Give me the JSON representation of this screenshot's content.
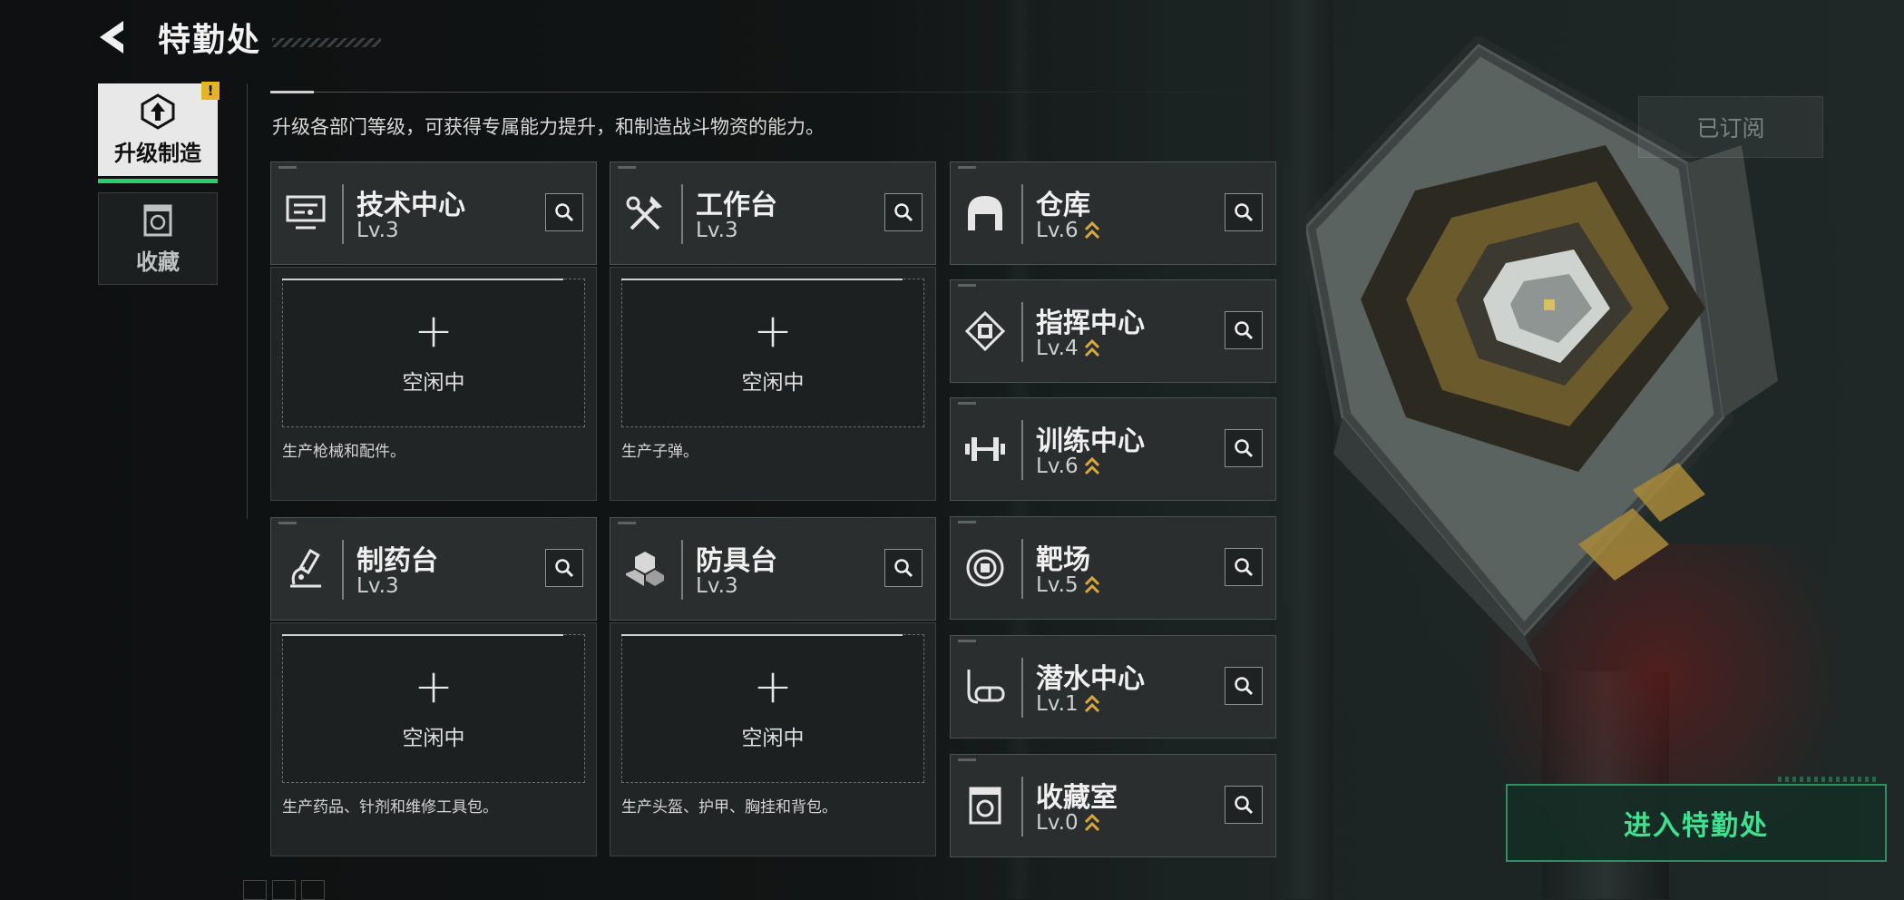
{
  "header": {
    "title": "特勤处"
  },
  "sidebar": {
    "items": [
      {
        "label": "升级制造",
        "active": true,
        "badge": "!"
      },
      {
        "label": "收藏",
        "active": false
      }
    ]
  },
  "description": "升级各部门等级，可获得专属能力提升，和制造战斗物资的能力。",
  "subscribed_label": "已订阅",
  "big_cards": [
    {
      "name": "技术中心",
      "level": "Lv.3",
      "icon": "monitor-icon",
      "slot_status": "空闲中",
      "slot_desc": "生产枪械和配件。"
    },
    {
      "name": "工作台",
      "level": "Lv.3",
      "icon": "tools-icon",
      "slot_status": "空闲中",
      "slot_desc": "生产子弹。"
    },
    {
      "name": "制药台",
      "level": "Lv.3",
      "icon": "microscope-icon",
      "slot_status": "空闲中",
      "slot_desc": "生产药品、针剂和维修工具包。"
    },
    {
      "name": "防具台",
      "level": "Lv.3",
      "icon": "cubes-icon",
      "slot_status": "空闲中",
      "slot_desc": "生产头盔、护甲、胸挂和背包。"
    }
  ],
  "small_cards": [
    {
      "name": "仓库",
      "level": "Lv.6",
      "icon": "warehouse-icon"
    },
    {
      "name": "指挥中心",
      "level": "Lv.4",
      "icon": "chip-icon"
    },
    {
      "name": "训练中心",
      "level": "Lv.6",
      "icon": "dumbbell-icon"
    },
    {
      "name": "靶场",
      "level": "Lv.5",
      "icon": "target-icon"
    },
    {
      "name": "潜水中心",
      "level": "Lv.1",
      "icon": "diving-mask-icon"
    },
    {
      "name": "收藏室",
      "level": "Lv.0",
      "icon": "collection-icon"
    }
  ],
  "enter_button": "进入特勤处",
  "colors": {
    "accent_green": "#3fe08f",
    "upgrade_gold": "#d8a93a",
    "badge_yellow": "#e6b422"
  }
}
